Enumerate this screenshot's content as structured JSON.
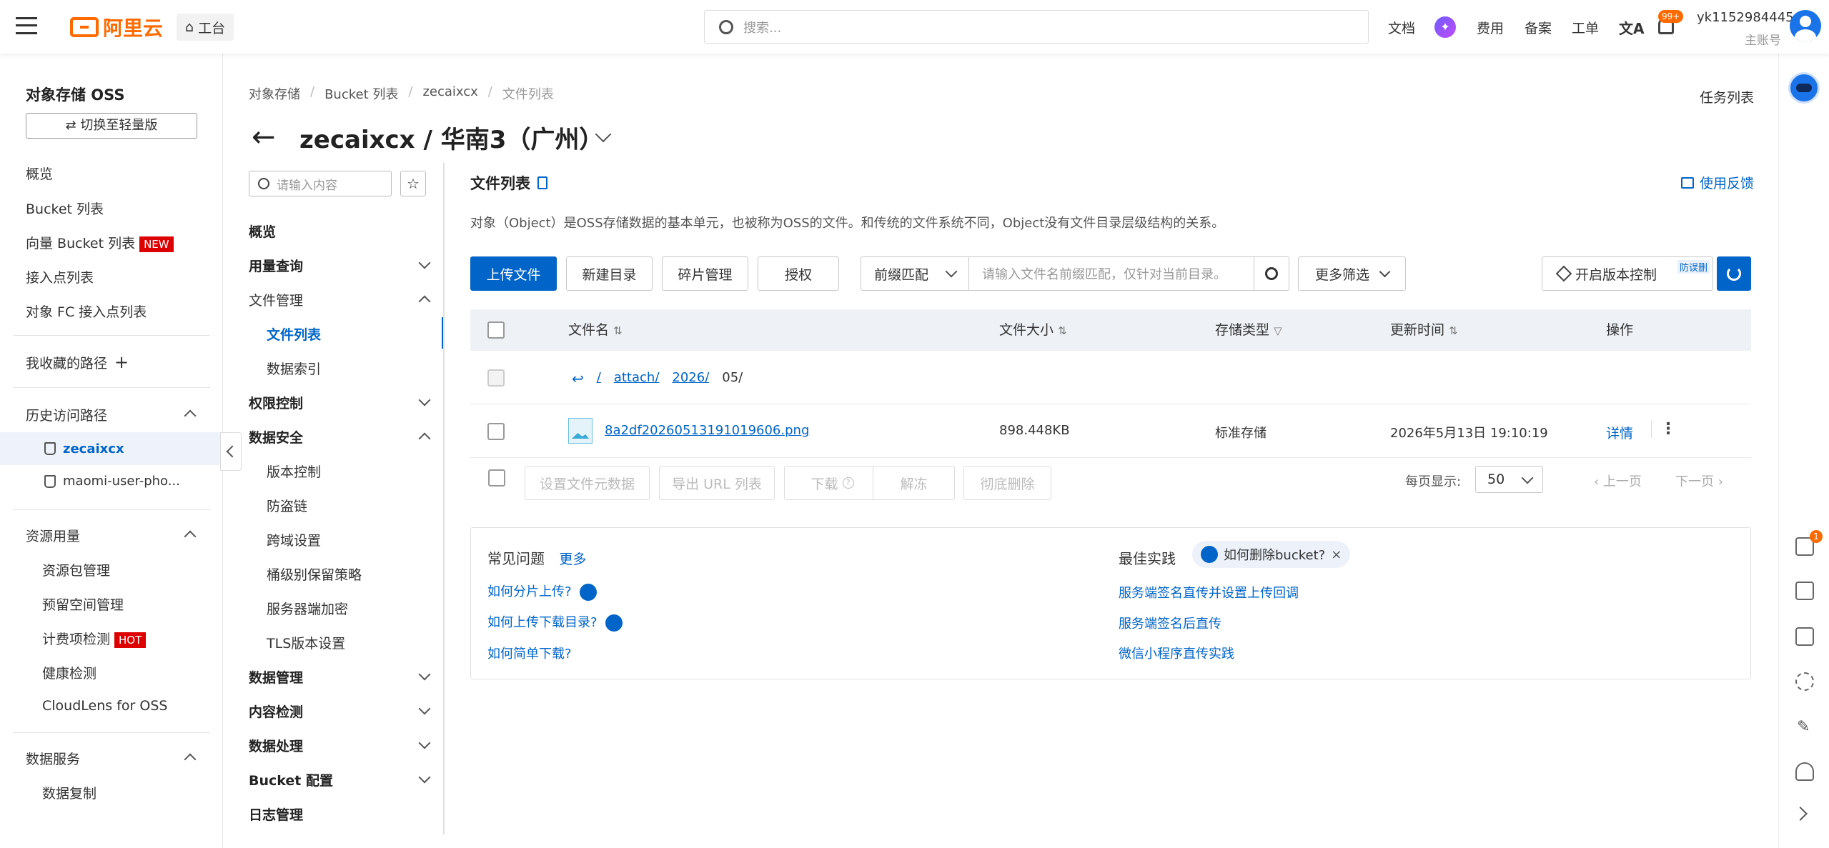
{
  "topbar": {
    "brand": "阿里云",
    "workbench": "工台",
    "search_placeholder": "搜索...",
    "links": [
      "文档",
      "费用",
      "备案",
      "工单"
    ],
    "notify_badge": "99+",
    "user_name": "yk1152984445",
    "user_role": "主账号"
  },
  "sidebar": {
    "title": "对象存储 OSS",
    "switch_button": "⇄ 切换至轻量版",
    "items": [
      "概览",
      "Bucket 列表",
      "向量 Bucket 列表",
      "接入点列表",
      "对象 FC 接入点列表"
    ],
    "vector_badge": "NEW",
    "favorites": "我收藏的路径",
    "history_title": "历史访问路径",
    "history_items": [
      "zecaixcx",
      "maomi-user-pho..."
    ],
    "resource_title": "资源用量",
    "resource_items": [
      "资源包管理",
      "预留空间管理",
      "计费项检测",
      "健康检测",
      "CloudLens for OSS"
    ],
    "hot_badge": "HOT",
    "data_service_title": "数据服务",
    "data_service_items": [
      "数据复制"
    ]
  },
  "breadcrumb": [
    "对象存储",
    "Bucket 列表",
    "zecaixcx",
    "文件列表"
  ],
  "task_list": "任务列表",
  "page_title": "zecaixcx / 华南3（广州）",
  "subnav": {
    "search_placeholder": "请输入内容",
    "overview": "概览",
    "usage": "用量查询",
    "file_mgmt": "文件管理",
    "file_list": "文件列表",
    "data_index": "数据索引",
    "access_control": "权限控制",
    "data_security": "数据安全",
    "security_items": [
      "版本控制",
      "防盗链",
      "跨域设置",
      "桶级别保留策略",
      "服务器端加密",
      "TLS版本设置"
    ],
    "data_mgmt": "数据管理",
    "content_check": "内容检测",
    "data_process": "数据处理",
    "bucket_config": "Bucket 配置",
    "log_mgmt": "日志管理"
  },
  "main": {
    "section_title": "文件列表",
    "feedback": "使用反馈",
    "description": "对象（Object）是OSS存储数据的基本单元，也被称为OSS的文件。和传统的文件系统不同，Object没有文件目录层级结构的关系。",
    "buttons": {
      "upload": "上传文件",
      "new_dir": "新建目录",
      "fragments": "碎片管理",
      "authorize": "授权",
      "match_mode": "前缀匹配",
      "more_filter": "更多筛选",
      "versioning": "开启版本控制",
      "anti_delete": "防误删"
    },
    "filter_placeholder": "请输入文件名前缀匹配，仅针对当前目录。",
    "columns": [
      "文件名",
      "文件大小",
      "存储类型",
      "更新时间",
      "操作"
    ],
    "path": {
      "root": "/",
      "seg1": "attach/",
      "seg2": "2026/",
      "current": "05/"
    },
    "file": {
      "name": "8a2df20260513191019606.png",
      "size": "898.448KB",
      "storage": "标准存储",
      "updated": "2026年5月13日 19:10:19",
      "detail": "详情"
    },
    "bulk": [
      "设置文件元数据",
      "导出 URL 列表",
      "下载",
      "解冻",
      "彻底删除"
    ],
    "pagination": {
      "label": "每页显示:",
      "size": "50",
      "prev": "上一页",
      "next": "下一页"
    }
  },
  "faq": {
    "title": "常见问题",
    "more": "更多",
    "items": [
      "如何分片上传?",
      "如何上传下载目录?",
      "如何简单下载?"
    ],
    "best_title": "最佳实践",
    "best_tag": "如何删除bucket?",
    "best_items": [
      "服务端签名直传并设置上传回调",
      "服务端签名后直传",
      "微信小程序直传实践"
    ]
  },
  "rightbar": {
    "notice_badge": "1"
  },
  "colors": {
    "brand": "#ff6a00",
    "primary": "#0064c8",
    "hot": "#d00000"
  }
}
